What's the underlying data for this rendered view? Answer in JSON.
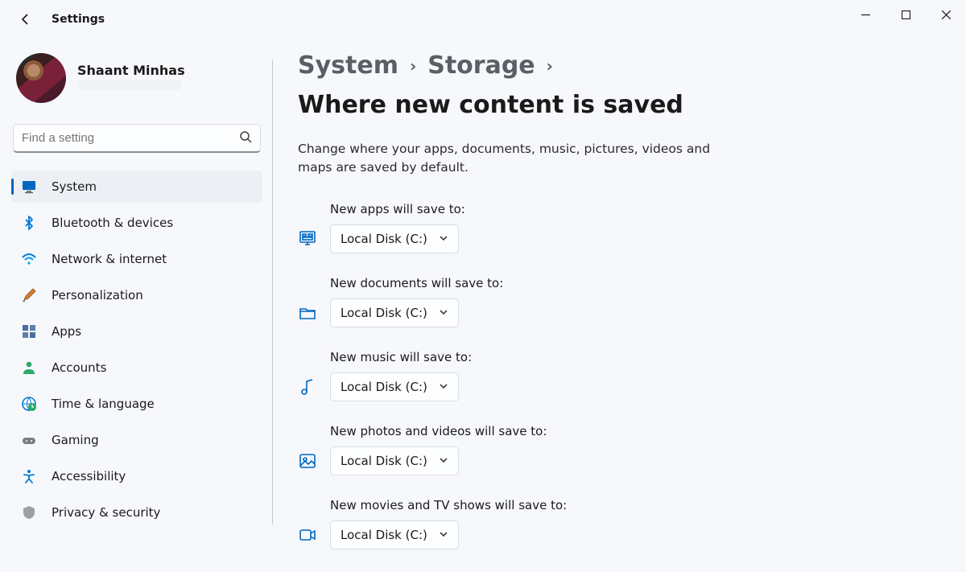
{
  "colors": {
    "accent": "#0067c0"
  },
  "titlebar": {
    "app_name": "Settings"
  },
  "profile": {
    "name": "Shaant Minhas"
  },
  "search": {
    "placeholder": "Find a setting"
  },
  "sidebar": {
    "items": [
      {
        "label": "System",
        "selected": true
      },
      {
        "label": "Bluetooth & devices"
      },
      {
        "label": "Network & internet"
      },
      {
        "label": "Personalization"
      },
      {
        "label": "Apps"
      },
      {
        "label": "Accounts"
      },
      {
        "label": "Time & language"
      },
      {
        "label": "Gaming"
      },
      {
        "label": "Accessibility"
      },
      {
        "label": "Privacy & security"
      }
    ]
  },
  "breadcrumb": {
    "parts": [
      {
        "label": "System",
        "link": true
      },
      {
        "label": "Storage",
        "link": true
      },
      {
        "label": "Where new content is saved",
        "link": false
      }
    ]
  },
  "description": "Change where your apps, documents, music, pictures, videos and maps are saved by default.",
  "settings": [
    {
      "label": "New apps will save to:",
      "value": "Local Disk (C:)",
      "icon": "monitor"
    },
    {
      "label": "New documents will save to:",
      "value": "Local Disk (C:)",
      "icon": "folder"
    },
    {
      "label": "New music will save to:",
      "value": "Local Disk (C:)",
      "icon": "music"
    },
    {
      "label": "New photos and videos will save to:",
      "value": "Local Disk (C:)",
      "icon": "image"
    },
    {
      "label": "New movies and TV shows will save to:",
      "value": "Local Disk (C:)",
      "icon": "video"
    }
  ]
}
